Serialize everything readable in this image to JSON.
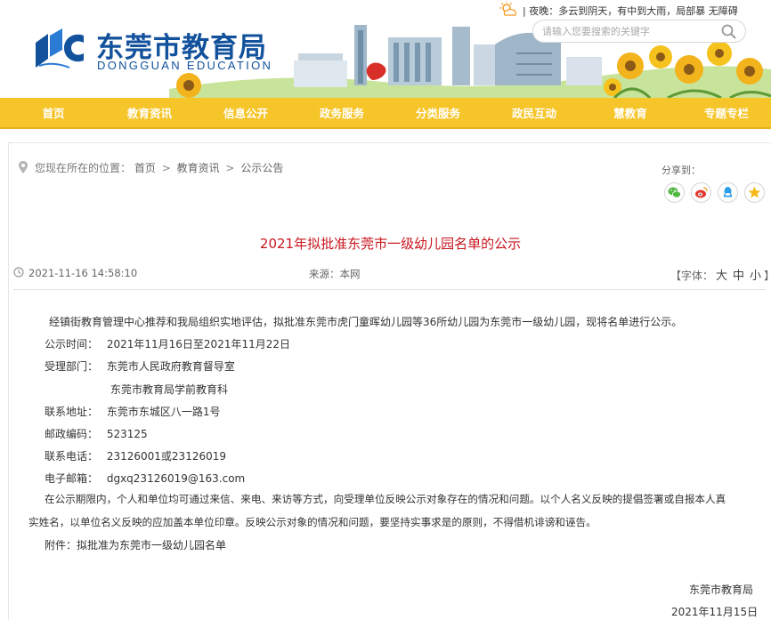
{
  "header": {
    "title": "东莞市教育局",
    "subtitle": "DONGGUAN EDUCATION",
    "weather": "| 夜晚：多云到阴天，有中到大雨，局部暴  无障碍",
    "search_placeholder": "请输入您要搜索的关键字"
  },
  "nav": {
    "items": [
      "首页",
      "教育资讯",
      "信息公开",
      "政务服务",
      "分类服务",
      "政民互动",
      "慧教育",
      "专题专栏"
    ]
  },
  "breadcrumb": {
    "prefix": "您现在所在的位置：",
    "items": [
      "首页",
      "教育资讯",
      "公示公告"
    ],
    "separator": ">"
  },
  "share": {
    "label": "分享到：",
    "items": [
      "wechat",
      "weibo",
      "qq",
      "favorite"
    ]
  },
  "article": {
    "title": "2021年拟批准东莞市一级幼儿园名单的公示",
    "date": "2021-11-16 14:58:10",
    "source": "来源：本网",
    "font_label": "【字体：",
    "font_sizes": [
      "大",
      "中",
      "小"
    ],
    "font_close": "】",
    "intro": "经镇街教育管理中心推荐和我局组织实地评估，拟批准东莞市虎门童晖幼儿园等36所幼儿园为东莞市一级幼儿园，现将名单进行公示。",
    "fields": [
      {
        "label": "公示时间：",
        "value": "2021年11月16日至2021年11月22日"
      },
      {
        "label": "受理部门：",
        "value": "东莞市人民政府教育督导室"
      },
      {
        "label": "",
        "value": "东莞市教育局学前教育科"
      },
      {
        "label": "联系地址：",
        "value": "东莞市东城区八一路1号"
      },
      {
        "label": "邮政编码：",
        "value": "523125"
      },
      {
        "label": "联系电话：",
        "value": "23126001或23126019"
      },
      {
        "label": "电子邮箱：",
        "value": "dgxq23126019@163.com"
      }
    ],
    "notice_line1": "在公示期限内，个人和单位均可通过来信、来电、来访等方式，向受理单位反映公示对象存在的情况和问题。以个人名义反映的提倡签署或自报本人真",
    "notice_line2": "实姓名，以单位名义反映的应加盖本单位印章。反映公示对象的情况和问题，要坚持实事求是的原则，不得借机诽谤和诬告。",
    "attachment": "附件：拟批准为东莞市一级幼儿园名单",
    "signature": "东莞市教育局",
    "sign_date": "2021年11月15日"
  },
  "colors": {
    "nav_bg": "#f6c52a",
    "brand_blue": "#12519c",
    "title_red": "#c8161e"
  }
}
